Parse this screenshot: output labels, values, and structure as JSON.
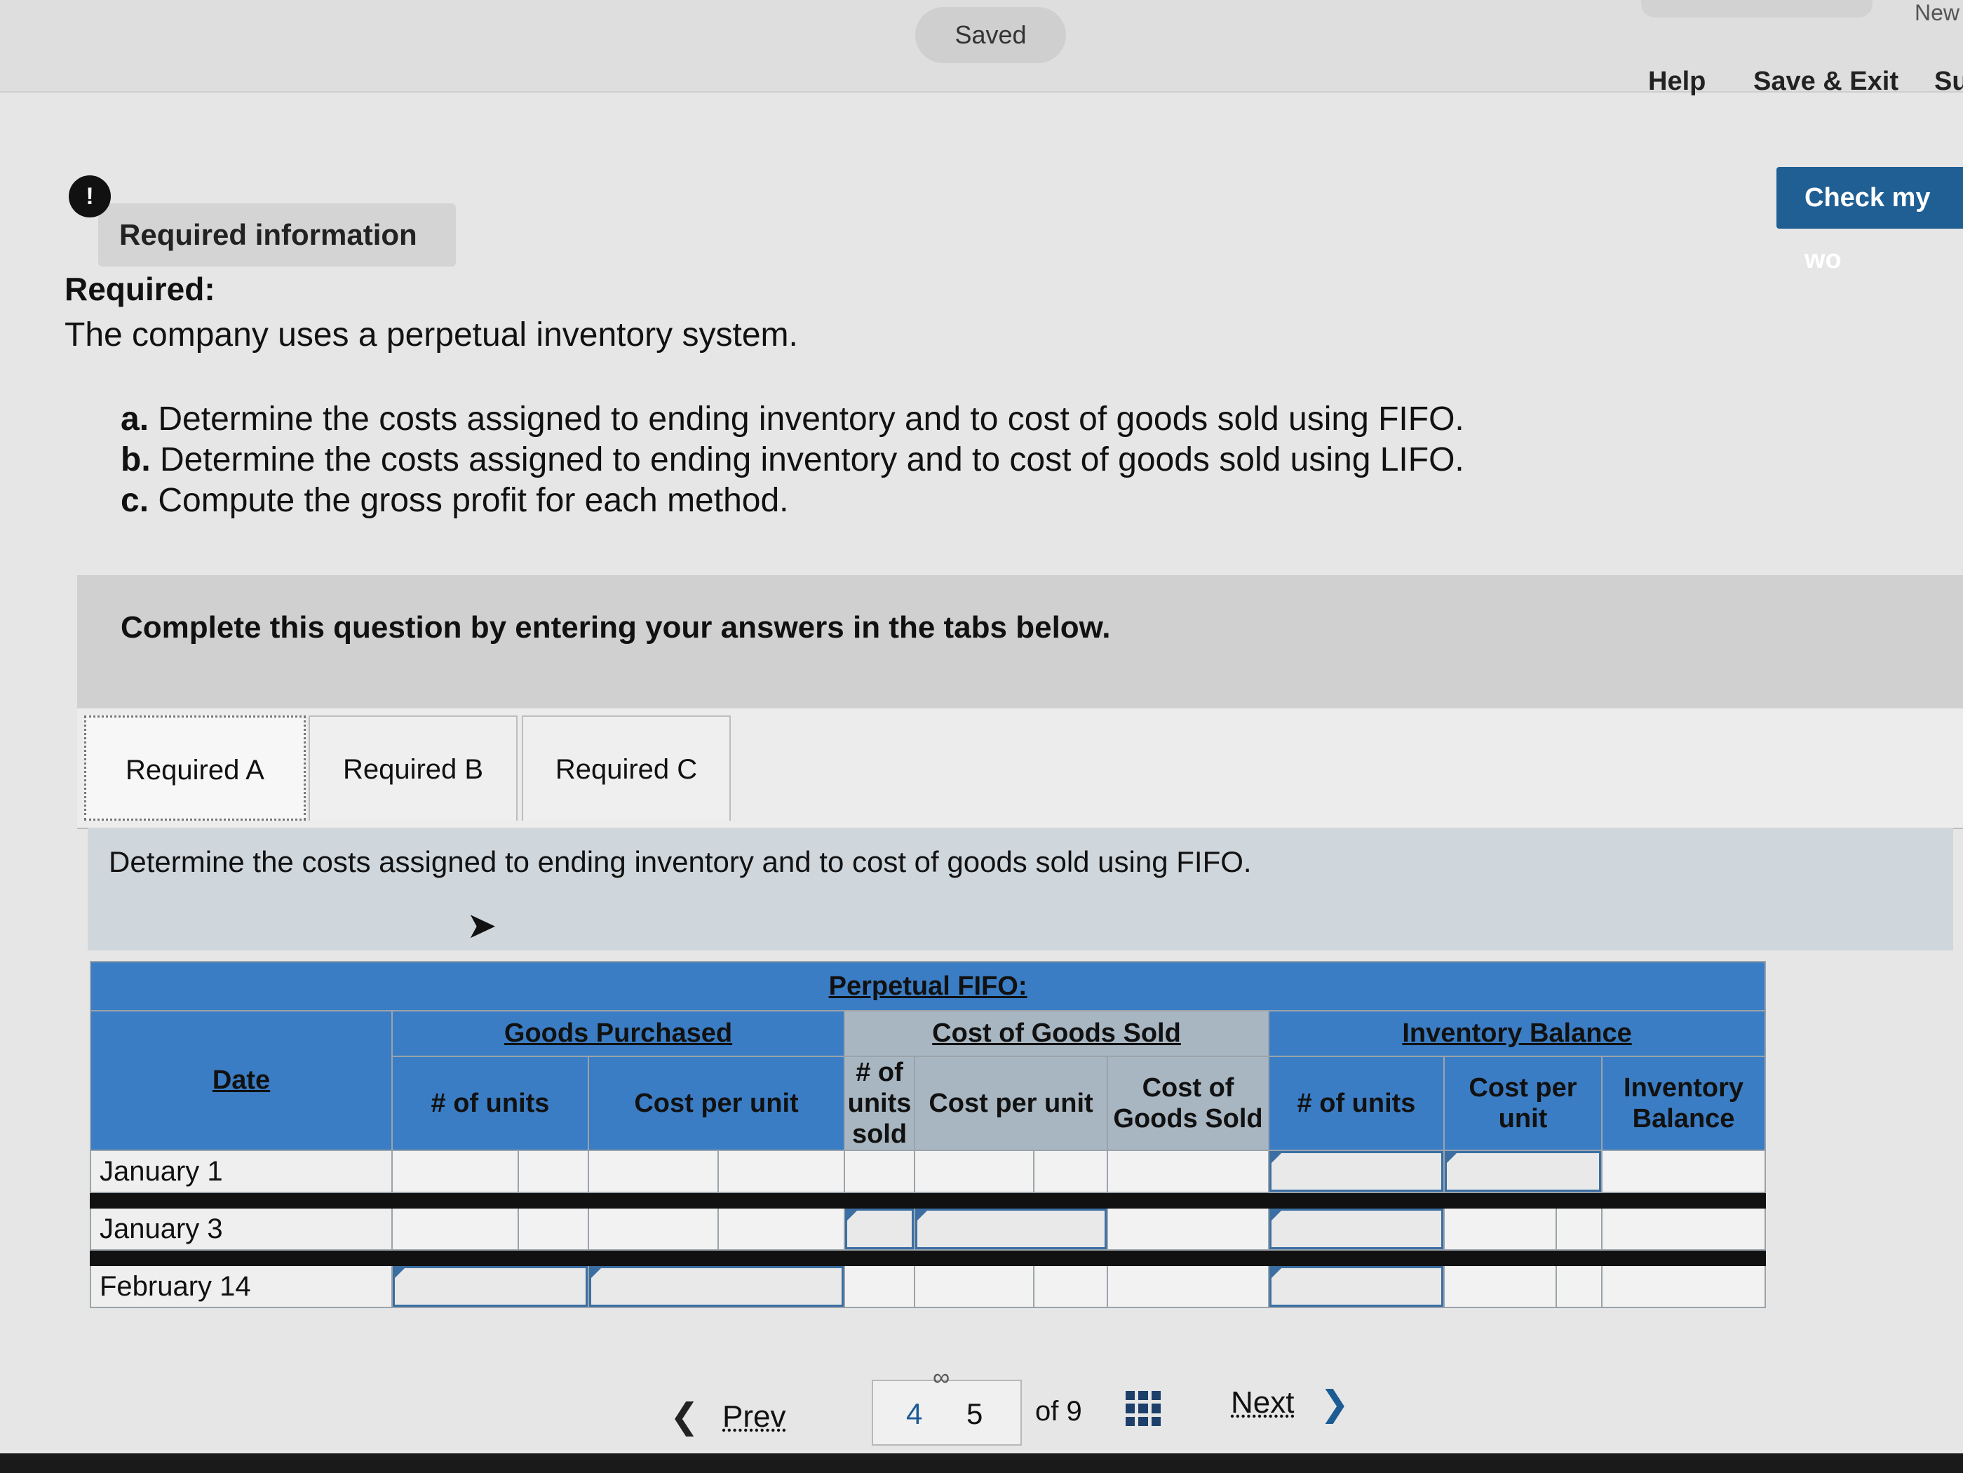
{
  "header": {
    "saved": "Saved",
    "help": "Help",
    "save_exit": "Save & Exit",
    "submit": "Su",
    "new": "New",
    "check_my_work": "Check my wo"
  },
  "required_info": {
    "alert": "!",
    "label": "Required information"
  },
  "question": {
    "required_label": "Required:",
    "intro": "The company uses a perpetual inventory system.",
    "items": [
      {
        "letter": "a.",
        "text": "Determine the costs assigned to ending inventory and to cost of goods sold using FIFO."
      },
      {
        "letter": "b.",
        "text": "Determine the costs assigned to ending inventory and to cost of goods sold using LIFO."
      },
      {
        "letter": "c.",
        "text": "Compute the gross profit for each method."
      }
    ],
    "panel_title": "Complete this question by entering your answers in the tabs below."
  },
  "tabs": [
    {
      "label": "Required A"
    },
    {
      "label": "Required B"
    },
    {
      "label": "Required C"
    }
  ],
  "instruction": "Determine the costs assigned to ending inventory and to cost of goods sold using FIFO.",
  "table": {
    "title": "Perpetual FIFO:",
    "groups": {
      "date": "Date",
      "purchased": "Goods Purchased",
      "cogs": "Cost of Goods Sold",
      "balance": "Inventory Balance"
    },
    "columns": {
      "p_units": "# of units",
      "p_cost": "Cost per unit",
      "s_units": "# of units sold",
      "s_cost": "Cost per unit",
      "s_total": "Cost of Goods Sold",
      "b_units": "# of units",
      "b_cost": "Cost per unit",
      "b_total": "Inventory Balance"
    },
    "rows": [
      {
        "date": "January 1"
      },
      {
        "date": "January 3"
      },
      {
        "date": "February 14"
      }
    ]
  },
  "pager": {
    "prev": "Prev",
    "current_prev": "4",
    "current": "5",
    "of": "of 9",
    "next": "Next"
  }
}
